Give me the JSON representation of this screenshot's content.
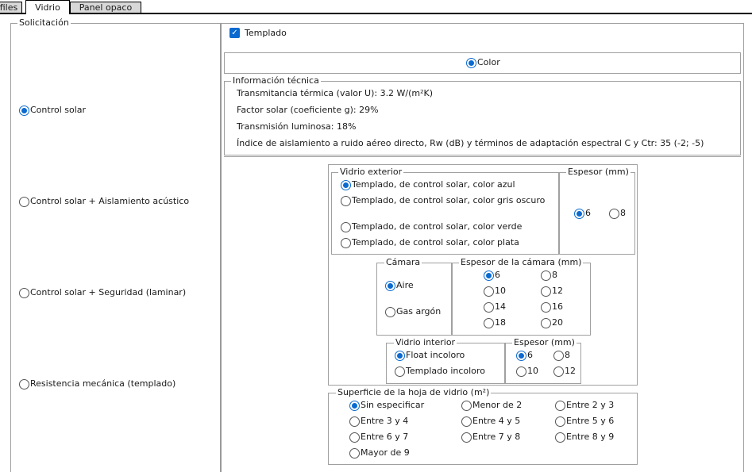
{
  "tabs": [
    "files",
    "Vidrio",
    "Panel opaco"
  ],
  "solicitacion": {
    "legend": "Solicitación",
    "options": [
      {
        "label": "Control solar",
        "selected": true
      },
      {
        "label": "Control solar + Aislamiento acústico",
        "selected": false
      },
      {
        "label": "Control solar + Seguridad (laminar)",
        "selected": false
      },
      {
        "label": "Resistencia mecánica (templado)",
        "selected": false
      }
    ]
  },
  "templado": {
    "label": "Templado",
    "checked": true
  },
  "color": {
    "label": "Color",
    "selected": true
  },
  "info": {
    "legend": "Información técnica",
    "lines": [
      "Transmitancia térmica (valor U): 3.2 W/(m²K)",
      "Factor solar (coeficiente g): 29%",
      "Transmisión luminosa: 18%",
      "Índice de aislamiento a ruido aéreo directo, Rw (dB) y términos de adaptación espectral C y Ctr: 35 (-2; -5)"
    ]
  },
  "vidrio_exterior": {
    "legend": "Vidrio exterior",
    "options": [
      {
        "label": "Templado, de control solar, color azul",
        "selected": true
      },
      {
        "label": "Templado, de control solar, color gris oscuro",
        "selected": false
      },
      {
        "label": "Templado, de control solar, color verde",
        "selected": false
      },
      {
        "label": "Templado, de control solar, color plata",
        "selected": false
      }
    ]
  },
  "espesor_exterior": {
    "legend": "Espesor (mm)",
    "options": [
      {
        "label": "6",
        "selected": true
      },
      {
        "label": "8",
        "selected": false
      }
    ]
  },
  "camara": {
    "legend": "Cámara",
    "options": [
      {
        "label": "Aire",
        "selected": true
      },
      {
        "label": "Gas argón",
        "selected": false
      }
    ]
  },
  "espesor_camara": {
    "legend": "Espesor de la cámara (mm)",
    "options": [
      {
        "label": "6",
        "selected": true
      },
      {
        "label": "8",
        "selected": false
      },
      {
        "label": "10",
        "selected": false
      },
      {
        "label": "12",
        "selected": false
      },
      {
        "label": "14",
        "selected": false
      },
      {
        "label": "16",
        "selected": false
      },
      {
        "label": "18",
        "selected": false
      },
      {
        "label": "20",
        "selected": false
      }
    ]
  },
  "vidrio_interior": {
    "legend": "Vidrio interior",
    "options": [
      {
        "label": "Float incoloro",
        "selected": true
      },
      {
        "label": "Templado incoloro",
        "selected": false
      }
    ]
  },
  "espesor_interior": {
    "legend": "Espesor (mm)",
    "options": [
      {
        "label": "6",
        "selected": true
      },
      {
        "label": "8",
        "selected": false
      },
      {
        "label": "10",
        "selected": false
      },
      {
        "label": "12",
        "selected": false
      }
    ]
  },
  "superficie": {
    "legend": "Superficie de la hoja de vidrio (m²)",
    "options": [
      {
        "label": "Sin especificar",
        "selected": true
      },
      {
        "label": "Menor de 2",
        "selected": false
      },
      {
        "label": "Entre 2 y 3",
        "selected": false
      },
      {
        "label": "Entre 3 y 4",
        "selected": false
      },
      {
        "label": "Entre 4 y 5",
        "selected": false
      },
      {
        "label": "Entre 5 y 6",
        "selected": false
      },
      {
        "label": "Entre 6 y 7",
        "selected": false
      },
      {
        "label": "Entre 7 y 8",
        "selected": false
      },
      {
        "label": "Entre 8 y 9",
        "selected": false
      },
      {
        "label": "Mayor de 9",
        "selected": false
      }
    ]
  }
}
